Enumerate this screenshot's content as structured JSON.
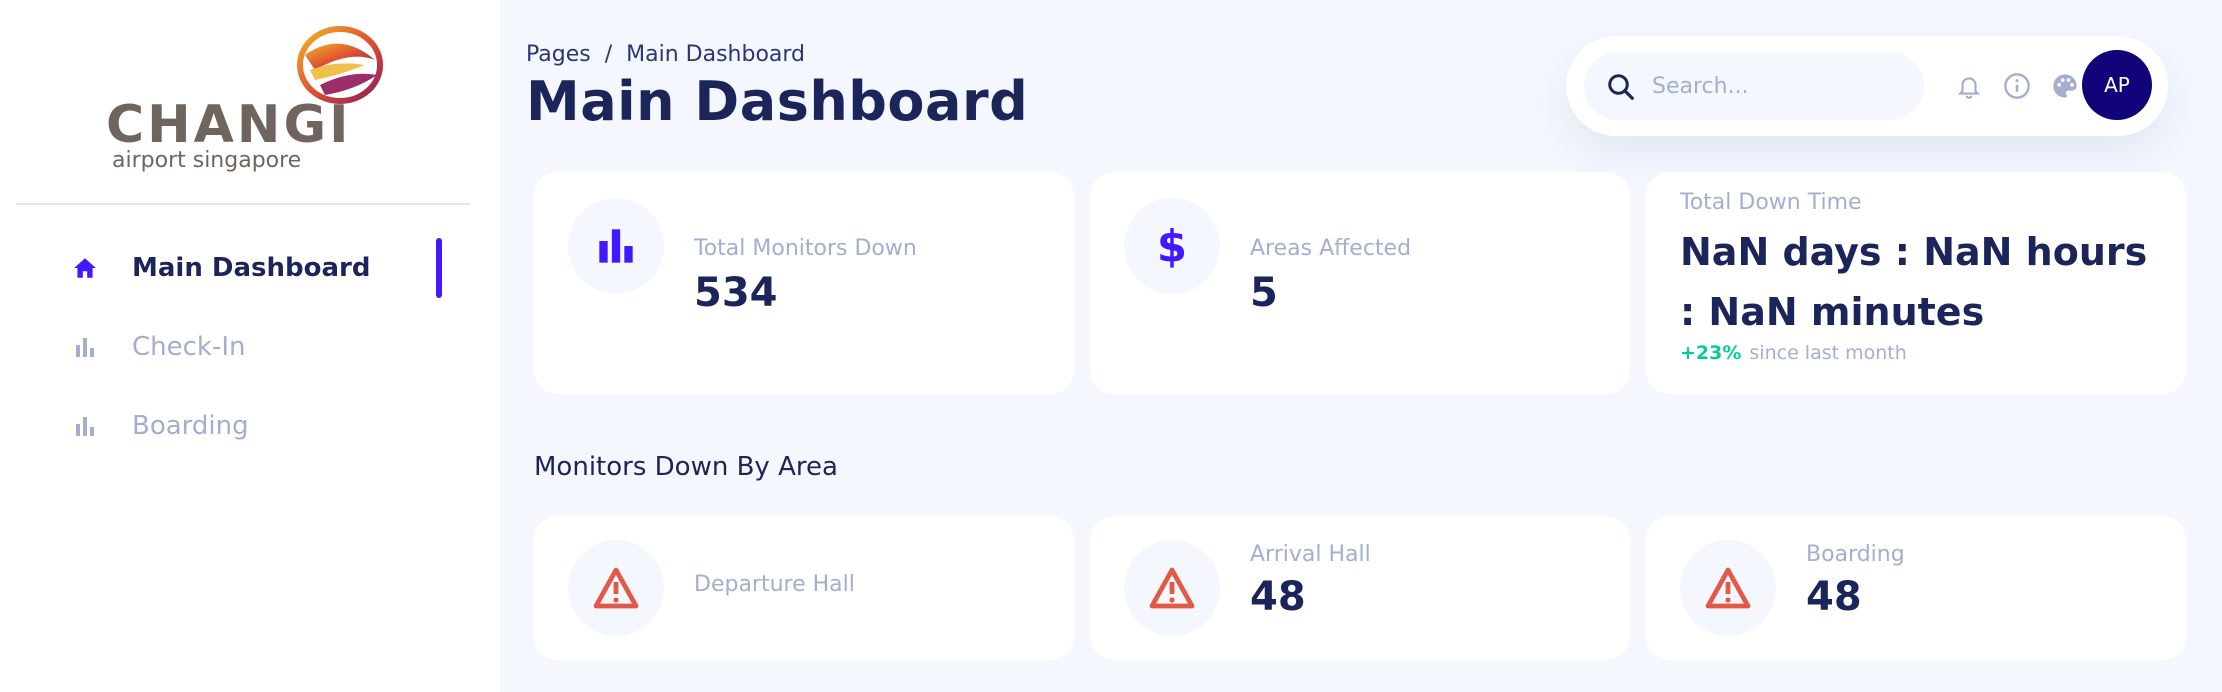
{
  "brand": {
    "logo_word": "CHANGI",
    "logo_sub": "airport singapore"
  },
  "sidebar": {
    "items": [
      {
        "label": "Main Dashboard",
        "icon": "home-icon",
        "active": true
      },
      {
        "label": "Check-In",
        "icon": "bar-chart-icon",
        "active": false
      },
      {
        "label": "Boarding",
        "icon": "bar-chart-icon",
        "active": false
      }
    ]
  },
  "header": {
    "breadcrumb": [
      "Pages",
      "/",
      "Main Dashboard"
    ],
    "title": "Main Dashboard",
    "search_placeholder": "Search...",
    "avatar_initials": "AP",
    "icons": [
      "bell-icon",
      "info-icon",
      "palette-icon"
    ]
  },
  "stats": {
    "monitors": {
      "label": "Total Monitors Down",
      "value": "534",
      "icon": "bar-chart-icon"
    },
    "areas": {
      "label": "Areas Affected",
      "value": "5",
      "icon": "dollar-icon"
    },
    "downtime": {
      "label": "Total Down Time",
      "value": "NaN days : NaN hours : NaN minutes",
      "trend_pct": "+23%",
      "trend_text": "since last month"
    }
  },
  "section_title": "Monitors Down By Area",
  "areas": [
    {
      "label": "Departure Hall",
      "value": "",
      "icon": "warning-icon"
    },
    {
      "label": "Arrival Hall",
      "value": "48",
      "icon": "warning-icon"
    },
    {
      "label": "Boarding",
      "value": "48",
      "icon": "warning-icon"
    }
  ],
  "colors": {
    "accent": "#4318ff",
    "navy": "#1b2559",
    "muted": "#a3aed0",
    "background": "#f4f7fe",
    "avatar": "#11047a",
    "warning": "#e05a47",
    "positive": "#05cd99"
  }
}
